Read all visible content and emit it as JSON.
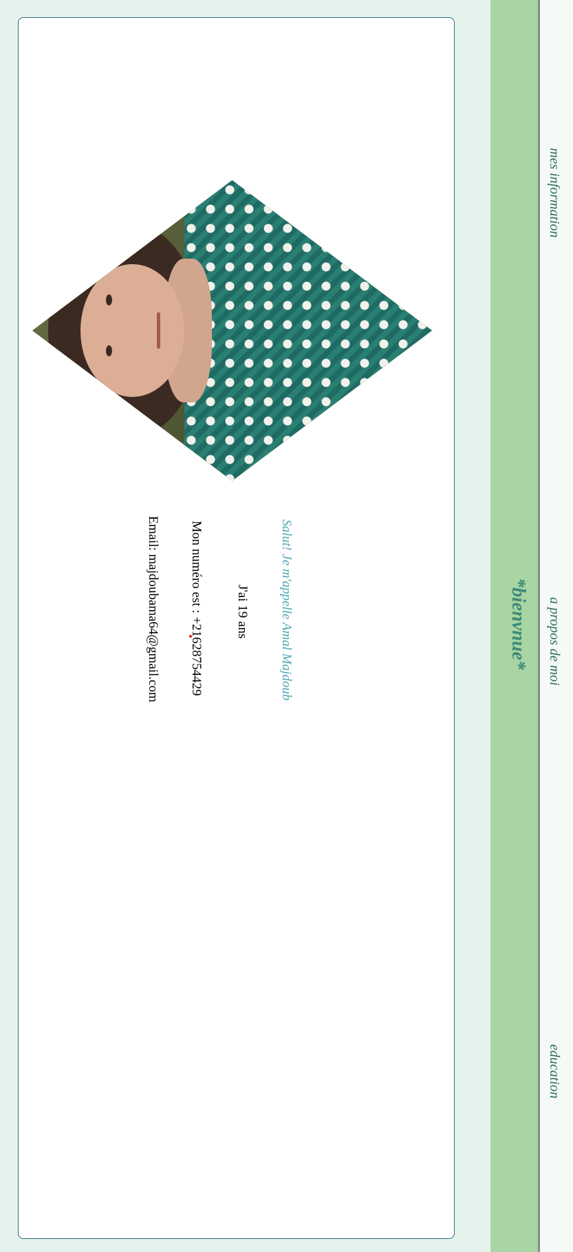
{
  "nav": {
    "items": [
      {
        "label": "mes information"
      },
      {
        "label": "a propos de moi"
      },
      {
        "label": "education"
      }
    ]
  },
  "banner": {
    "title": "*bienvnue*"
  },
  "profile": {
    "photo_label": "profile-photo",
    "greeting": "Salut! Je m'appelle Amal Majdoub",
    "age": "J'ai 19 ans",
    "phone": "Mon numéro est : +21628754429",
    "email": "Email: majdoubama64@gmail.com"
  },
  "colors": {
    "background": "#e3f3ec",
    "banner": "#a8d5a3",
    "accent_text": "#4aa6b4",
    "nav_text": "#2e6b62"
  }
}
